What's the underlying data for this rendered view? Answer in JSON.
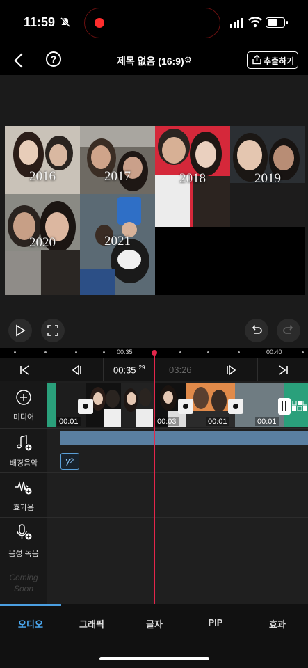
{
  "status_bar": {
    "time": "11:59"
  },
  "header": {
    "title": "제목 없음 (16:9)",
    "export_label": "추출하기"
  },
  "preview": {
    "years": [
      "2016",
      "2017",
      "2018",
      "2019",
      "2020",
      "2021"
    ]
  },
  "timeline": {
    "ruler_labels": [
      "00:35",
      "00:40"
    ],
    "current_time": "00:35",
    "current_frame": "29",
    "duration": "03:26",
    "clip_timestamps": [
      "00:01",
      "00:03",
      "00:01",
      "00:01"
    ]
  },
  "tracks": [
    {
      "label": "미디어",
      "icon": "plus-circle-icon"
    },
    {
      "label": "배경음악",
      "icon": "music-note-icon"
    },
    {
      "label": "효과음",
      "icon": "sound-wave-icon"
    },
    {
      "label": "음성 녹음",
      "icon": "microphone-icon"
    },
    {
      "label": "Coming Soon",
      "icon": ""
    }
  ],
  "audio_clip_label": "y2",
  "bottom_tabs": [
    "오디오",
    "그래픽",
    "글자",
    "PIP",
    "효과"
  ],
  "colors": {
    "accent": "#4ba8f0",
    "playhead": "#e3264b",
    "clip_green": "#2aa07b",
    "audio_bar": "#5a7fa1"
  }
}
